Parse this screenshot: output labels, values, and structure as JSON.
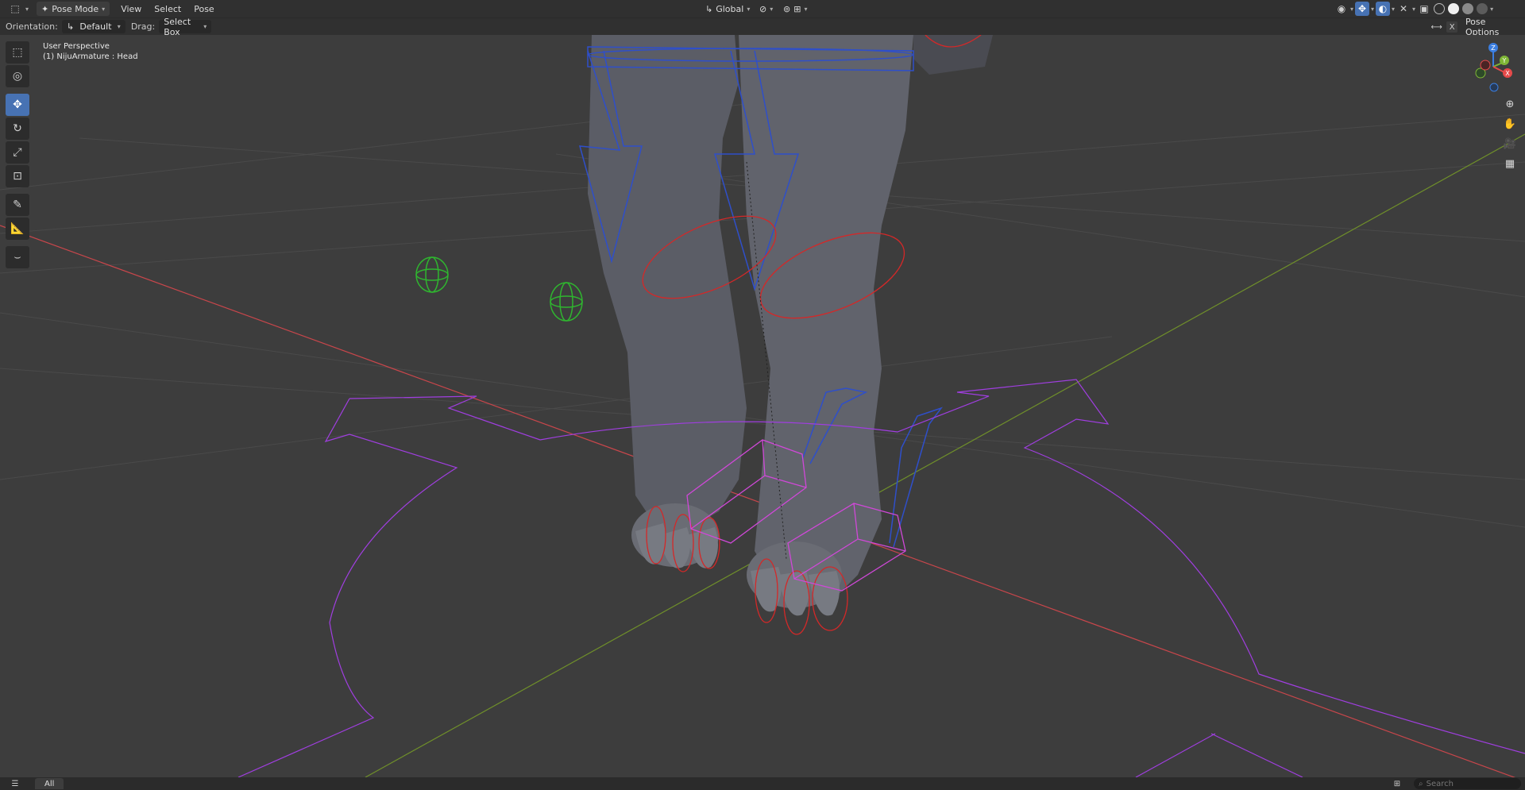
{
  "header": {
    "mode": "Pose Mode",
    "menus": [
      "View",
      "Select",
      "Pose"
    ],
    "transform_orientation": "Global",
    "pose_options": "Pose Options",
    "close_glyph": "X"
  },
  "tool_settings": {
    "orientation_label": "Orientation:",
    "orientation_value": "Default",
    "drag_label": "Drag:",
    "drag_value": "Select Box"
  },
  "viewport": {
    "perspective": "User Perspective",
    "active_object": "(1) NijuArmature : Head"
  },
  "gizmo": {
    "z": "Z",
    "y": "Y",
    "x": "X"
  },
  "statusbar": {
    "filter_tab": "All",
    "search_placeholder": "Search"
  },
  "colors": {
    "bone_blue": "#2f4fc9",
    "bone_red": "#d42828",
    "bone_green": "#2fb52f",
    "bone_magenta": "#d048d8",
    "bone_purple": "#a03ee0",
    "axis_x": "#c8464b",
    "axis_y": "#6f8f2a",
    "active_blue": "#4772b3"
  }
}
